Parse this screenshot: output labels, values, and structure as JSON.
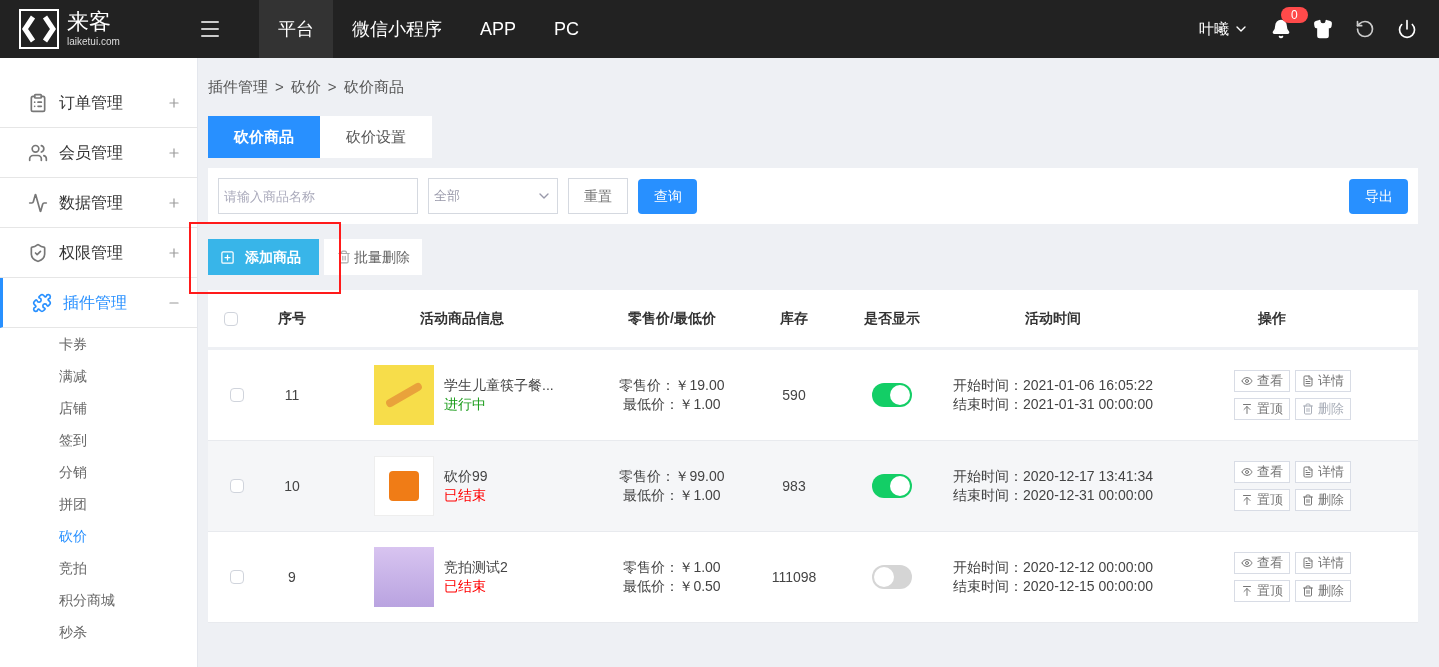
{
  "header": {
    "logo_text": "来客",
    "logo_domain": "laiketui.com",
    "tabs": [
      {
        "label": "平台",
        "selected": true
      },
      {
        "label": "微信小程序",
        "selected": false
      },
      {
        "label": "APP",
        "selected": false
      },
      {
        "label": "PC",
        "selected": false
      }
    ],
    "user": "叶曦",
    "notification_count": "0"
  },
  "sidebar": {
    "items": [
      {
        "label": "订单管理",
        "expanded": false,
        "selected": false
      },
      {
        "label": "会员管理",
        "expanded": false,
        "selected": false
      },
      {
        "label": "数据管理",
        "expanded": false,
        "selected": false
      },
      {
        "label": "权限管理",
        "expanded": false,
        "selected": false
      },
      {
        "label": "插件管理",
        "expanded": true,
        "selected": true,
        "children": [
          {
            "label": "卡券",
            "selected": false
          },
          {
            "label": "满减",
            "selected": false
          },
          {
            "label": "店铺",
            "selected": false
          },
          {
            "label": "签到",
            "selected": false
          },
          {
            "label": "分销",
            "selected": false
          },
          {
            "label": "拼团",
            "selected": false
          },
          {
            "label": "砍价",
            "selected": true
          },
          {
            "label": "竞拍",
            "selected": false
          },
          {
            "label": "积分商城",
            "selected": false
          },
          {
            "label": "秒杀",
            "selected": false
          }
        ]
      }
    ]
  },
  "breadcrumb": [
    "插件管理",
    ">",
    "砍价",
    ">",
    "砍价商品"
  ],
  "page_tabs": [
    {
      "label": "砍价商品",
      "selected": true
    },
    {
      "label": "砍价设置",
      "selected": false
    }
  ],
  "filter": {
    "name_placeholder": "请输入商品名称",
    "status_value": "全部",
    "reset": "重置",
    "query": "查询",
    "export": "导出"
  },
  "actions": {
    "add": "添加商品",
    "batch_delete": "批量删除"
  },
  "table": {
    "all_checked": false,
    "columns": [
      "序号",
      "活动商品信息",
      "零售价/最低价",
      "库存",
      "是否显示",
      "活动时间",
      "操作"
    ],
    "rows": [
      {
        "checked": false,
        "no": "11",
        "name": "学生儿童筷子餐...",
        "status": "进行中",
        "color": "#1a9c1a",
        "retail": "零售价：￥19.00",
        "lowest": "最低价：￥1.00",
        "stock": "590",
        "on": true,
        "start": "开始时间：2021-01-06 16:05:22",
        "end": "结束时间：2021-01-31 00:00:00",
        "buttons": [
          {
            "label": "查看",
            "disabled": false
          },
          {
            "label": "详情",
            "disabled": false
          },
          {
            "label": "置顶",
            "disabled": false
          },
          {
            "label": "删除",
            "disabled": true
          }
        ]
      },
      {
        "checked": false,
        "no": "10",
        "name": "砍价99",
        "status": "已结束",
        "color": "#ff0000",
        "retail": "零售价：￥99.00",
        "lowest": "最低价：￥1.00",
        "stock": "983",
        "on": true,
        "start": "开始时间：2020-12-17 13:41:34",
        "end": "结束时间：2020-12-31 00:00:00",
        "buttons": [
          {
            "label": "查看",
            "disabled": false
          },
          {
            "label": "详情",
            "disabled": false
          },
          {
            "label": "置顶",
            "disabled": false
          },
          {
            "label": "删除",
            "disabled": false
          }
        ]
      },
      {
        "checked": false,
        "no": "9",
        "name": "竞拍测试2",
        "status": "已结束",
        "color": "#ff0000",
        "retail": "零售价：￥1.00",
        "lowest": "最低价：￥0.50",
        "stock": "111098",
        "on": false,
        "start": "开始时间：2020-12-12 00:00:00",
        "end": "结束时间：2020-12-15 00:00:00",
        "buttons": [
          {
            "label": "查看",
            "disabled": false
          },
          {
            "label": "详情",
            "disabled": false
          },
          {
            "label": "置顶",
            "disabled": false
          },
          {
            "label": "删除",
            "disabled": false
          }
        ]
      }
    ]
  }
}
